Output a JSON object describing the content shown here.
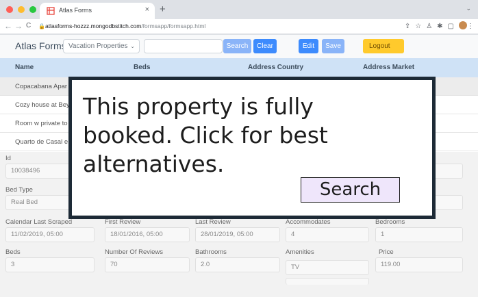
{
  "browser": {
    "tab_title": "Atlas Forms",
    "tab_close": "×",
    "new_tab": "+",
    "tab_menu": "⌄",
    "url_host": "atlasforms-hozzz.mongodbstitch.com",
    "url_path": "/formsapp/formsapp.html",
    "nav_back": "←",
    "nav_forward": "→",
    "nav_reload": "C"
  },
  "app": {
    "brand": "Atlas Forms",
    "collection_select": "Vacation Properties",
    "search_label": "Search",
    "clear_label": "Clear",
    "edit_label": "Edit",
    "save_label": "Save",
    "logout_label": "Logout"
  },
  "table": {
    "columns": [
      "Name",
      "Beds",
      "Address Country",
      "Address Market"
    ],
    "rows": [
      "Copacabana Apar",
      "Cozy house at Bey",
      "Room w private to",
      "Quarto de Casal e"
    ]
  },
  "detail": {
    "id_label": "Id",
    "id_value": "10038496",
    "bed_type_label": "Bed Type",
    "bed_type_value": "Real Bed",
    "calendar_label": "Calendar Last Scraped",
    "calendar_value": "11/02/2019, 05:00",
    "first_review_label": "First Review",
    "first_review_value": "18/01/2016, 05:00",
    "last_review_label": "Last Review",
    "last_review_value": "28/01/2019, 05:00",
    "accommodates_label": "Accommodates",
    "accommodates_value": "4",
    "bedrooms_label": "Bedrooms",
    "bedrooms_value": "1",
    "beds_label": "Beds",
    "beds_value": "3",
    "reviews_label": "Number Of Reviews",
    "reviews_value": "70",
    "bathrooms_label": "Bathrooms",
    "bathrooms_value": "2.0",
    "amenities_label": "Amenities",
    "amenities_value": "TV",
    "price_label": "Price",
    "price_value": "119.00"
  },
  "popup": {
    "message": "This property is fully booked. Click for best alternatives.",
    "button_label": "Search"
  }
}
